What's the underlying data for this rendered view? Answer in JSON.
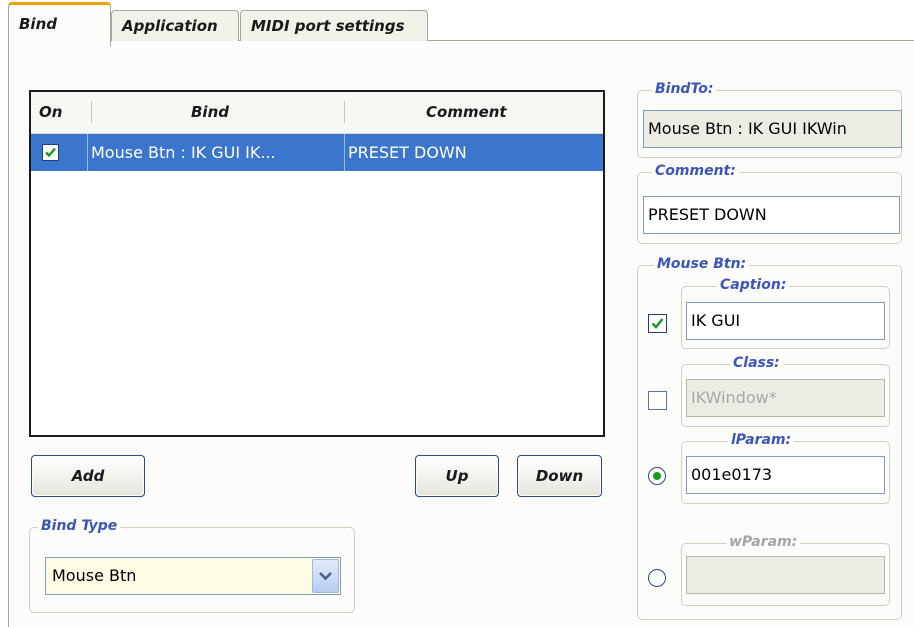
{
  "tabs": [
    {
      "label": "Bind",
      "active": true
    },
    {
      "label": "Application",
      "active": false
    },
    {
      "label": "MIDI port settings",
      "active": false
    }
  ],
  "binds_list": {
    "columns": [
      "On",
      "Bind",
      "Comment"
    ],
    "rows": [
      {
        "on": true,
        "bind": "Mouse Btn : IK GUI IK...",
        "comment": "PRESET DOWN",
        "selected": true
      }
    ]
  },
  "buttons": {
    "add": "Add",
    "up": "Up",
    "down": "Down"
  },
  "bind_type": {
    "legend": "Bind Type",
    "value": "Mouse Btn"
  },
  "bind_to": {
    "legend": "BindTo:",
    "value": "Mouse Btn : IK GUI IKWin"
  },
  "comment": {
    "legend": "Comment:",
    "value": "PRESET DOWN"
  },
  "mouse_btn": {
    "legend": "Mouse Btn:",
    "caption": {
      "legend": "Caption:",
      "value": "IK GUI",
      "checked": true
    },
    "class": {
      "legend": "Class:",
      "value": "IKWindow*",
      "checked": false
    },
    "lparam": {
      "legend": "lParam:",
      "value": "001e0173",
      "selected": true
    },
    "wparam": {
      "legend": "wParam:",
      "value": "",
      "selected": false
    }
  },
  "colors": {
    "selection": "#3b75cc",
    "legend_text": "#3b56b8",
    "active_tab_accent": "#f0a000",
    "check_green": "#1a9a1a"
  }
}
